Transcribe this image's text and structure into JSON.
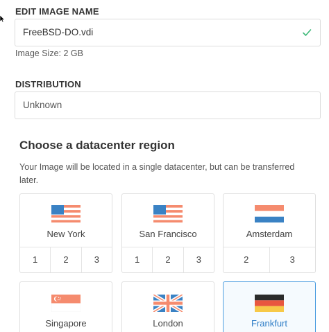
{
  "form": {
    "name_label": "EDIT IMAGE NAME",
    "name_value": "FreeBSD-DO.vdi",
    "image_size": "Image Size: 2 GB",
    "distribution_label": "DISTRIBUTION",
    "distribution_value": "Unknown"
  },
  "region": {
    "title": "Choose a datacenter region",
    "description": "Your Image will be located in a single datacenter, but can be transferred later.",
    "cards": [
      {
        "name": "New York",
        "numbers": [
          "1",
          "2",
          "3"
        ]
      },
      {
        "name": "San Francisco",
        "numbers": [
          "1",
          "2",
          "3"
        ]
      },
      {
        "name": "Amsterdam",
        "numbers": [
          "2",
          "3"
        ]
      },
      {
        "name": "Singapore"
      },
      {
        "name": "London"
      },
      {
        "name": "Frankfurt",
        "selected": true
      }
    ]
  },
  "colors": {
    "accent": "#2d7cc6",
    "check": "#3cb878",
    "flag_blue": "#3a82c4",
    "flag_salmon": "#f58b6e"
  }
}
